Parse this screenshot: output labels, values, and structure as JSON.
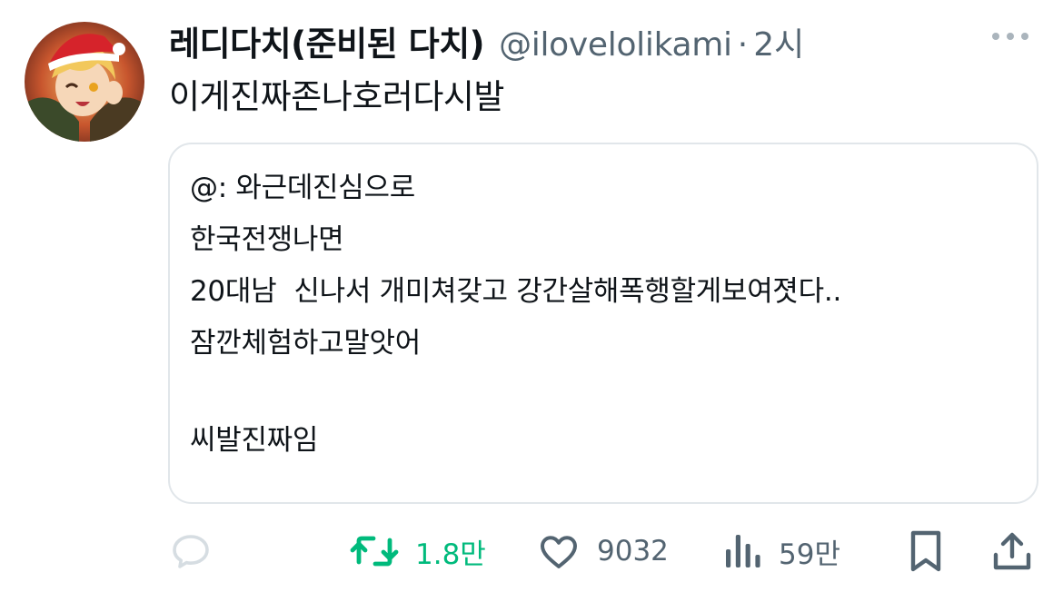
{
  "author": {
    "display_name": "레디다치(준비된 다치)",
    "handle": "@ilovelolikami",
    "separator": "·",
    "time": "2시"
  },
  "tweet": {
    "text": "이게진짜존나호러다시발"
  },
  "quote": {
    "lines": [
      "@: 와근데진심으로",
      "한국전쟁나면",
      "20대남  신나서 개미쳐갖고 강간살해폭행할게보여졋다..",
      "잠깐체험하고말앗어",
      "",
      "씨발진짜임"
    ]
  },
  "actions": {
    "reply": {
      "icon": "reply-icon",
      "count": ""
    },
    "retweet": {
      "icon": "retweet-icon",
      "count": "1.8만",
      "color": "#00ba7c"
    },
    "like": {
      "icon": "heart-icon",
      "count": "9032"
    },
    "views": {
      "icon": "views-icon",
      "count": "59만"
    },
    "bookmark": {
      "icon": "bookmark-icon"
    },
    "share": {
      "icon": "share-icon"
    }
  },
  "colors": {
    "text": "#0f1419",
    "secondary": "#536471",
    "border": "#e1e6ea",
    "retweet_green": "#00ba7c"
  }
}
